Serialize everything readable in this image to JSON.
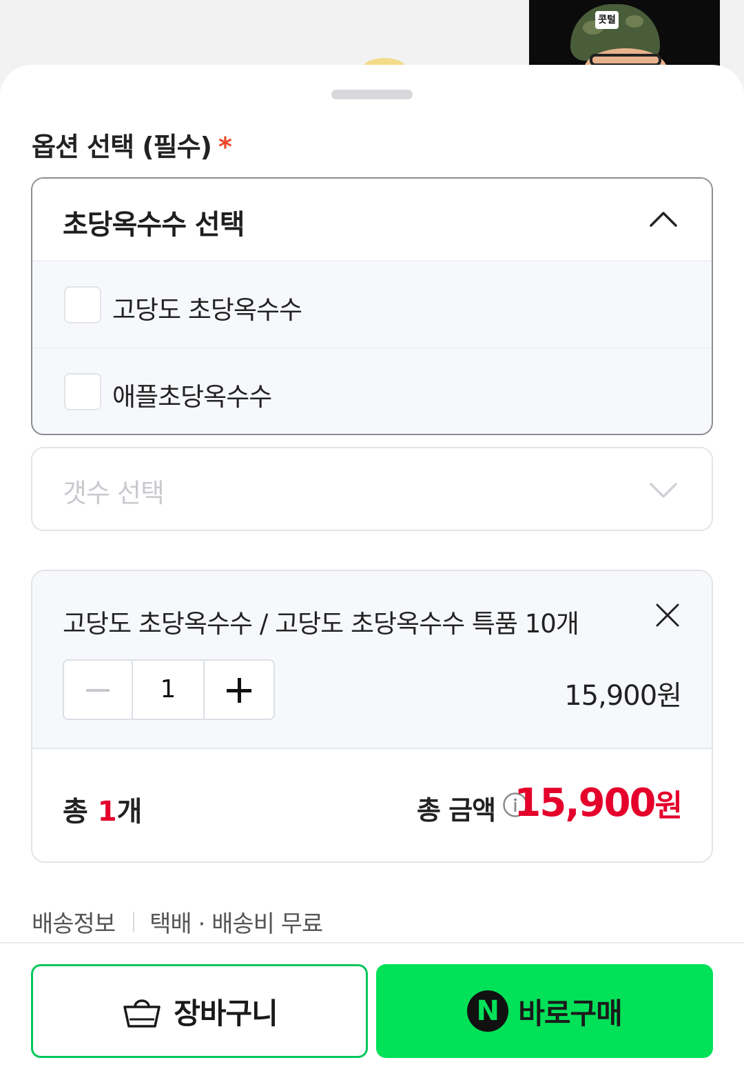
{
  "background": {
    "thumbnail_badge": "콧털"
  },
  "option_section": {
    "title": "옵션 선택 (필수)",
    "required_mark": "*"
  },
  "option_select": {
    "label": "초당옥수수 선택",
    "expanded": true,
    "options": [
      {
        "label": "고당도 초당옥수수",
        "checked": false
      },
      {
        "label": "애플초당옥수수",
        "checked": false
      }
    ]
  },
  "quantity_select": {
    "placeholder": "갯수 선택",
    "expanded": false
  },
  "cart": {
    "item": {
      "name": "고당도 초당옥수수 / 고당도 초당옥수수 특품 10개",
      "quantity": "1",
      "price": "15,900원"
    },
    "summary": {
      "count_prefix": "총 ",
      "count_number": "1",
      "count_suffix": "개",
      "total_label": "총 금액",
      "total_number": "15,900",
      "total_unit": "원"
    }
  },
  "delivery": {
    "label": "배송정보",
    "value": "택배 · 배송비 무료"
  },
  "buttons": {
    "cart_label": "장바구니",
    "buy_label": "바로구매",
    "npay_glyph": "N"
  },
  "colors": {
    "accent_green": "#03c75a",
    "buy_green": "#03e159",
    "price_red": "#e4002b",
    "required_red": "#ef4626"
  },
  "icons": [
    "basket-icon",
    "npay-icon",
    "chevron-up-icon",
    "chevron-down-icon",
    "close-icon",
    "info-icon",
    "minus-icon",
    "plus-icon"
  ]
}
